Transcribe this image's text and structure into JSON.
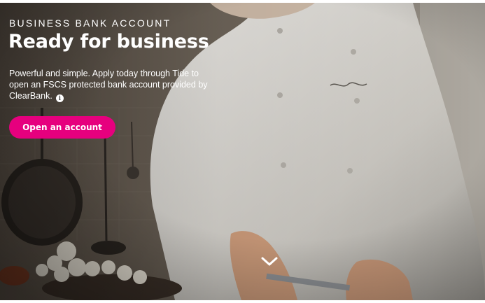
{
  "hero": {
    "eyebrow": "BUSINESS BANK ACCOUNT",
    "title": "Ready for business",
    "description": "Powerful and simple. Apply today through Tide to open an FSCS protected bank account provided by ClearBank.",
    "info_icon": "info-icon",
    "info_glyph": "i",
    "cta_label": "Open an account",
    "scroll_icon": "chevron-down-icon",
    "background_image": "chef in white jacket slicing food in a kitchen"
  },
  "colors": {
    "cta_background": "#e6007e",
    "text": "#ffffff"
  }
}
